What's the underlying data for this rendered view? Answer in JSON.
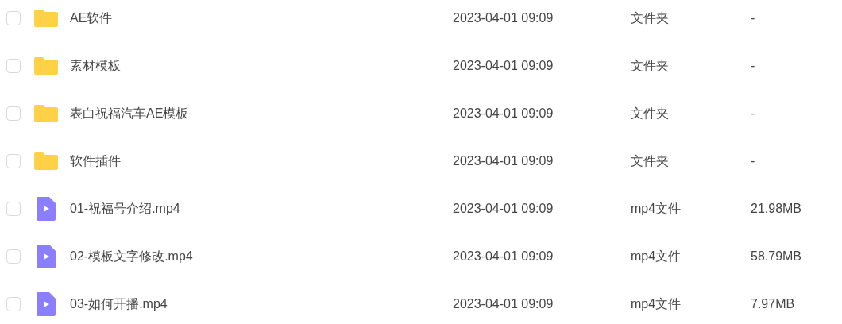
{
  "files": [
    {
      "kind": "folder",
      "checked": false,
      "name": "AE软件",
      "modified": "2023-04-01 09:09",
      "type": "文件夹",
      "size": "-"
    },
    {
      "kind": "folder",
      "checked": false,
      "name": "素材模板",
      "modified": "2023-04-01 09:09",
      "type": "文件夹",
      "size": "-"
    },
    {
      "kind": "folder",
      "checked": false,
      "name": "表白祝福汽车AE模板",
      "modified": "2023-04-01 09:09",
      "type": "文件夹",
      "size": "-"
    },
    {
      "kind": "folder",
      "checked": false,
      "name": "软件插件",
      "modified": "2023-04-01 09:09",
      "type": "文件夹",
      "size": "-"
    },
    {
      "kind": "video",
      "checked": false,
      "name": "01-祝福号介绍.mp4",
      "modified": "2023-04-01 09:09",
      "type": "mp4文件",
      "size": "21.98MB"
    },
    {
      "kind": "video",
      "checked": false,
      "name": "02-模板文字修改.mp4",
      "modified": "2023-04-01 09:09",
      "type": "mp4文件",
      "size": "58.79MB"
    },
    {
      "kind": "video",
      "checked": false,
      "name": "03-如何开播.mp4",
      "modified": "2023-04-01 09:09",
      "type": "mp4文件",
      "size": "7.97MB"
    }
  ]
}
